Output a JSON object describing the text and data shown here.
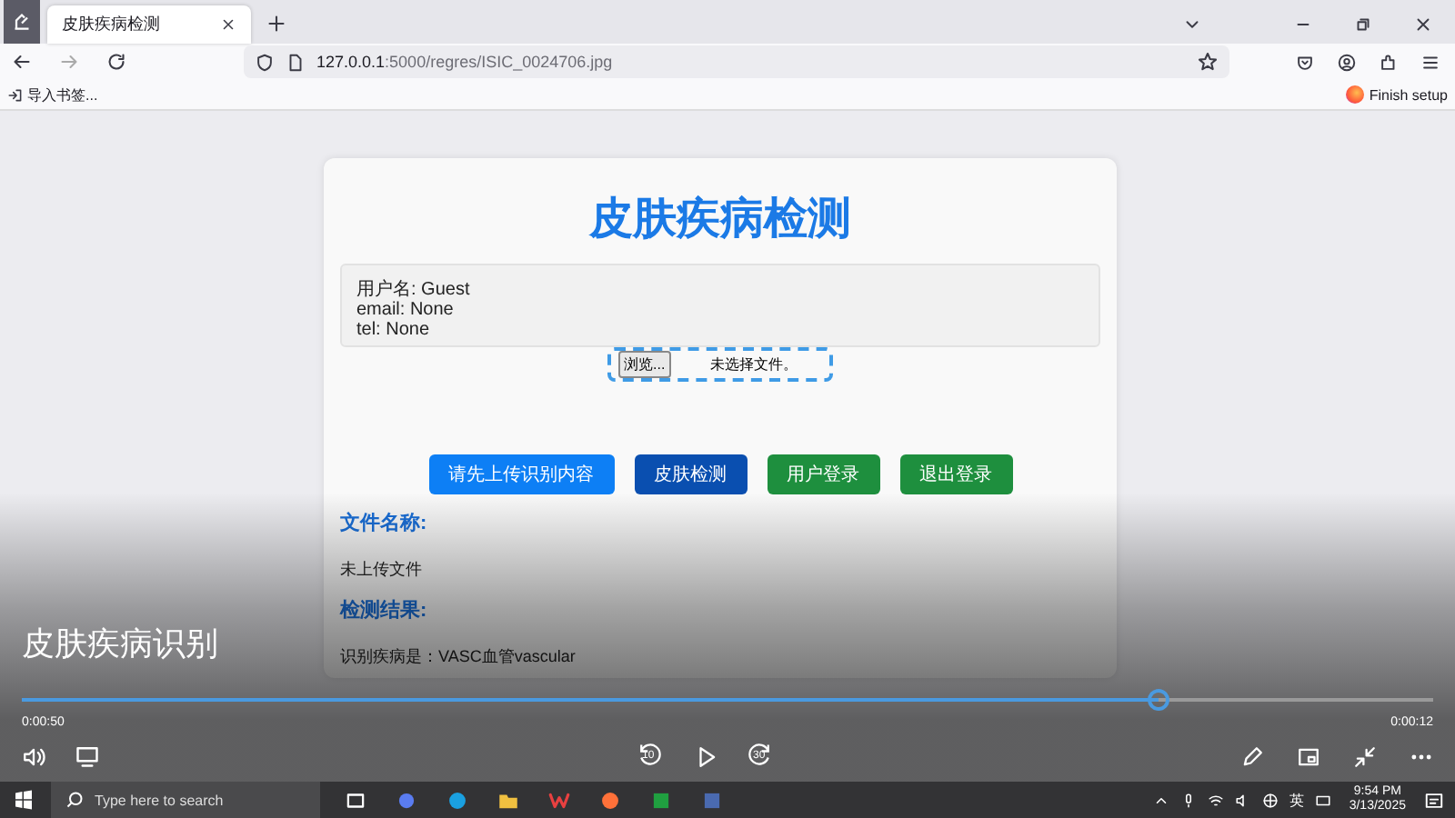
{
  "browser": {
    "tabs": [
      {
        "title": "皮肤疾病检测",
        "selected": true
      }
    ],
    "url_host": "127.0.0.1",
    "url_path": ":5000/regres/ISIC_0024706.jpg",
    "bookmark": "导入书签...",
    "finish_setup": "Finish setup"
  },
  "page": {
    "title": "皮肤疾病检测",
    "user_info": [
      "用户名: Guest",
      "email: None",
      "tel: None"
    ],
    "file_input": {
      "button": "浏览...",
      "status": "未选择文件。"
    },
    "buttons": [
      {
        "label": "请先上传识别内容",
        "kind": "primary"
      },
      {
        "label": "皮肤检测",
        "kind": "dark"
      },
      {
        "label": "用户登录",
        "kind": "success"
      },
      {
        "label": "退出登录",
        "kind": "success"
      }
    ],
    "sections": [
      {
        "heading": "文件名称:",
        "text": "未上传文件"
      },
      {
        "heading": "检测结果:",
        "text": "识别疾病是：VASC血管vascular"
      }
    ]
  },
  "video": {
    "title": "皮肤疾病识别",
    "progress": {
      "level": 0.805
    },
    "elapsed": "0:00:50",
    "remaining": "0:00:12",
    "rewind": "10",
    "forward": "30"
  },
  "taskbar": {
    "search_placeholder": "Type here to search",
    "ime": "英",
    "time": "9:54 PM",
    "date": "3/13/2025"
  }
}
